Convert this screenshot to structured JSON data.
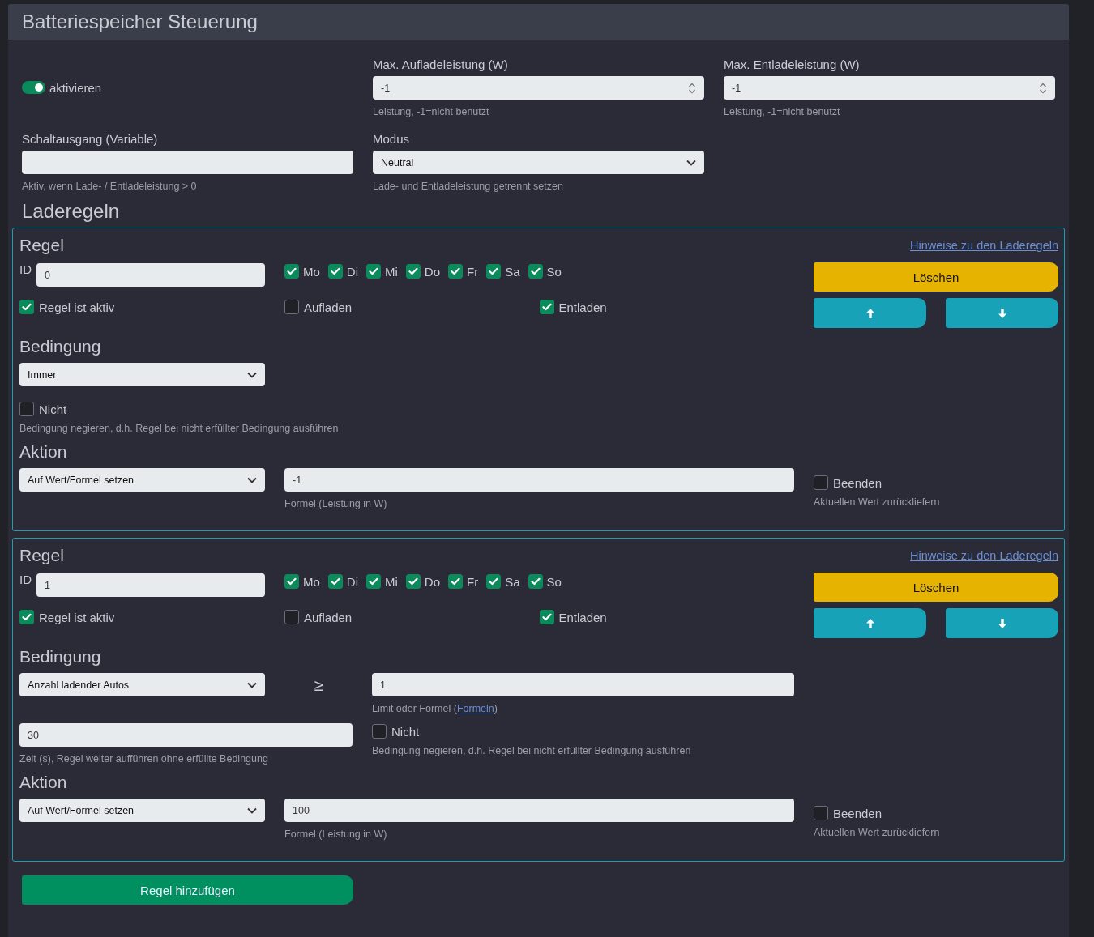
{
  "title": "Batteriespeicher Steuerung",
  "enable": {
    "label": "aktivieren",
    "on": true
  },
  "max_charge": {
    "label": "Max. Aufladeleistung (W)",
    "value": "-1",
    "hint": "Leistung, -1=nicht benutzt"
  },
  "max_discharge": {
    "label": "Max. Entladeleistung (W)",
    "value": "-1",
    "hint": "Leistung, -1=nicht benutzt"
  },
  "switch_output": {
    "label": "Schaltausgang (Variable)",
    "hint": "Aktiv, wenn Lade- / Entladeleistung > 0"
  },
  "mode": {
    "label": "Modus",
    "value": "Neutral",
    "hint": "Lade- und Entladeleistung getrennt setzen"
  },
  "rules_heading": "Laderegeln",
  "rules": [
    {
      "title": "Regel",
      "help_link": "Hinweise zu den Laderegeln",
      "id_label": "ID",
      "id_value": "0",
      "days": [
        {
          "label": "Mo",
          "checked": true
        },
        {
          "label": "Di",
          "checked": true
        },
        {
          "label": "Mi",
          "checked": true
        },
        {
          "label": "Do",
          "checked": true
        },
        {
          "label": "Fr",
          "checked": true
        },
        {
          "label": "Sa",
          "checked": true
        },
        {
          "label": "So",
          "checked": true
        }
      ],
      "active": {
        "label": "Regel ist aktiv",
        "checked": true
      },
      "charge": {
        "label": "Aufladen",
        "checked": false
      },
      "discharge": {
        "label": "Entladen",
        "checked": true
      },
      "delete_button": "Löschen",
      "condition_heading": "Bedingung",
      "condition": {
        "kind": "always",
        "select": "Immer",
        "negate": {
          "label": "Nicht",
          "checked": false
        },
        "negate_hint": "Bedingung negieren, d.h. Regel bei nicht erfüllter Bedingung ausführen"
      },
      "action_heading": "Aktion",
      "action": {
        "select": "Auf Wert/Formel setzen",
        "value": "-1",
        "hint": "Formel (Leistung in W)",
        "finish": {
          "label": "Beenden",
          "checked": false
        },
        "finish_hint": "Aktuellen Wert zurückliefern"
      }
    },
    {
      "title": "Regel",
      "help_link": "Hinweise zu den Laderegeln",
      "id_label": "ID",
      "id_value": "1",
      "days": [
        {
          "label": "Mo",
          "checked": true
        },
        {
          "label": "Di",
          "checked": true
        },
        {
          "label": "Mi",
          "checked": true
        },
        {
          "label": "Do",
          "checked": true
        },
        {
          "label": "Fr",
          "checked": true
        },
        {
          "label": "Sa",
          "checked": true
        },
        {
          "label": "So",
          "checked": true
        }
      ],
      "active": {
        "label": "Regel ist aktiv",
        "checked": true
      },
      "charge": {
        "label": "Aufladen",
        "checked": false
      },
      "discharge": {
        "label": "Entladen",
        "checked": true
      },
      "delete_button": "Löschen",
      "condition_heading": "Bedingung",
      "condition": {
        "kind": "comparison",
        "select": "Anzahl ladender Autos",
        "operator": "≥",
        "limit": "1",
        "limit_hint_before": "Limit oder Formel (",
        "limit_hint_link": "Formeln",
        "limit_hint_after": ")",
        "time": "30",
        "time_hint": "Zeit (s), Regel weiter aufführen ohne erfüllte Bedingung",
        "negate": {
          "label": "Nicht",
          "checked": false
        },
        "negate_hint": "Bedingung negieren, d.h. Regel bei nicht erfüllter Bedingung ausführen"
      },
      "action_heading": "Aktion",
      "action": {
        "select": "Auf Wert/Formel setzen",
        "value": "100",
        "hint": "Formel (Leistung in W)",
        "finish": {
          "label": "Beenden",
          "checked": false
        },
        "finish_hint": "Aktuellen Wert zurückliefern"
      }
    }
  ],
  "add_button": "Regel hinzufügen"
}
